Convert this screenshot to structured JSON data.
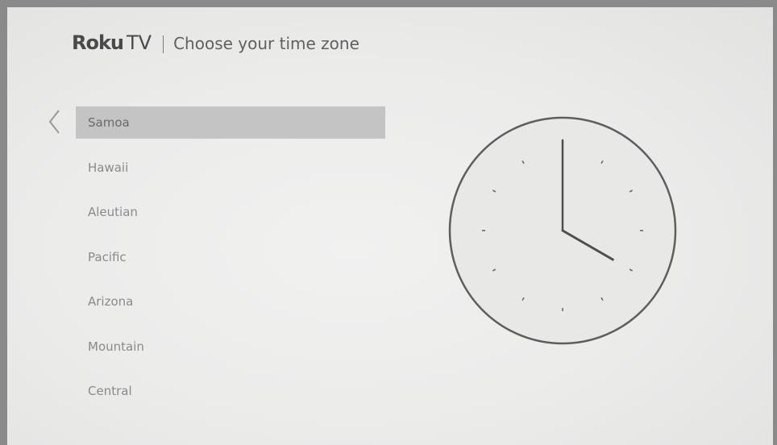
{
  "header": {
    "logo_roku": "Roku",
    "logo_tv": "TV",
    "title": "Choose your time zone"
  },
  "timezones": [
    {
      "label": "Samoa",
      "selected": true
    },
    {
      "label": "Hawaii",
      "selected": false
    },
    {
      "label": "Aleutian",
      "selected": false
    },
    {
      "label": "Pacific",
      "selected": false
    },
    {
      "label": "Arizona",
      "selected": false
    },
    {
      "label": "Mountain",
      "selected": false
    },
    {
      "label": "Central",
      "selected": false
    }
  ],
  "clock": {
    "hour": 4,
    "minute": 0
  },
  "icons": {
    "back": "chevron-left-icon"
  },
  "colors": {
    "background": "#ebebea",
    "highlight": "#c4c4c4",
    "text": "#8a8a8a",
    "clock_stroke": "#5e5e5e"
  }
}
